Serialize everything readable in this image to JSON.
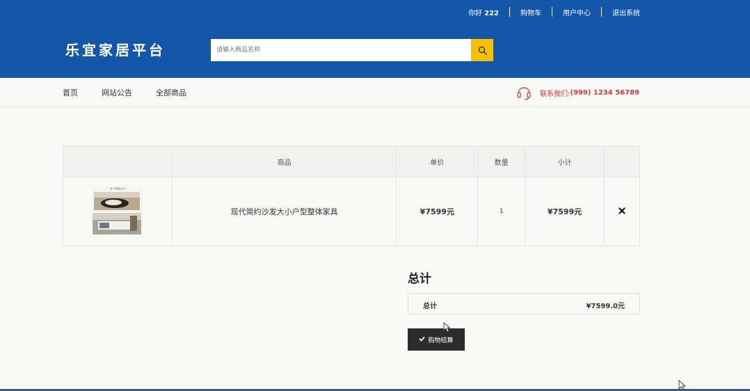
{
  "topbar": {
    "greeting_prefix": "你好",
    "username": "222",
    "links": [
      "购物车",
      "用户中心",
      "退出系统"
    ]
  },
  "header": {
    "logo": "乐宜家居平台",
    "search_placeholder": "请输入商品名称",
    "search_icon": "search-icon"
  },
  "nav": {
    "items": [
      "首页",
      "网站公告",
      "全部商品"
    ],
    "contact_label": "联系我们:",
    "contact_phone": "(999) 1234 56789"
  },
  "cart": {
    "headers": [
      "",
      "商品",
      "单价",
      "数量",
      "小计",
      ""
    ],
    "rows": [
      {
        "thumb_caption": "新一周新品上市",
        "name": "现代简约沙发大小户型整体家具",
        "price": "¥7599元",
        "qty": "1",
        "subtotal": "¥7599元"
      }
    ]
  },
  "totals": {
    "title": "总计",
    "label": "总计",
    "value": "¥7599.0元"
  },
  "checkout_label": "购物结算",
  "colors": {
    "header_blue": "#1457a8",
    "search_button": "#f6c000",
    "contact_red": "#d9363e",
    "checkout_dark": "#2c2c2c"
  }
}
